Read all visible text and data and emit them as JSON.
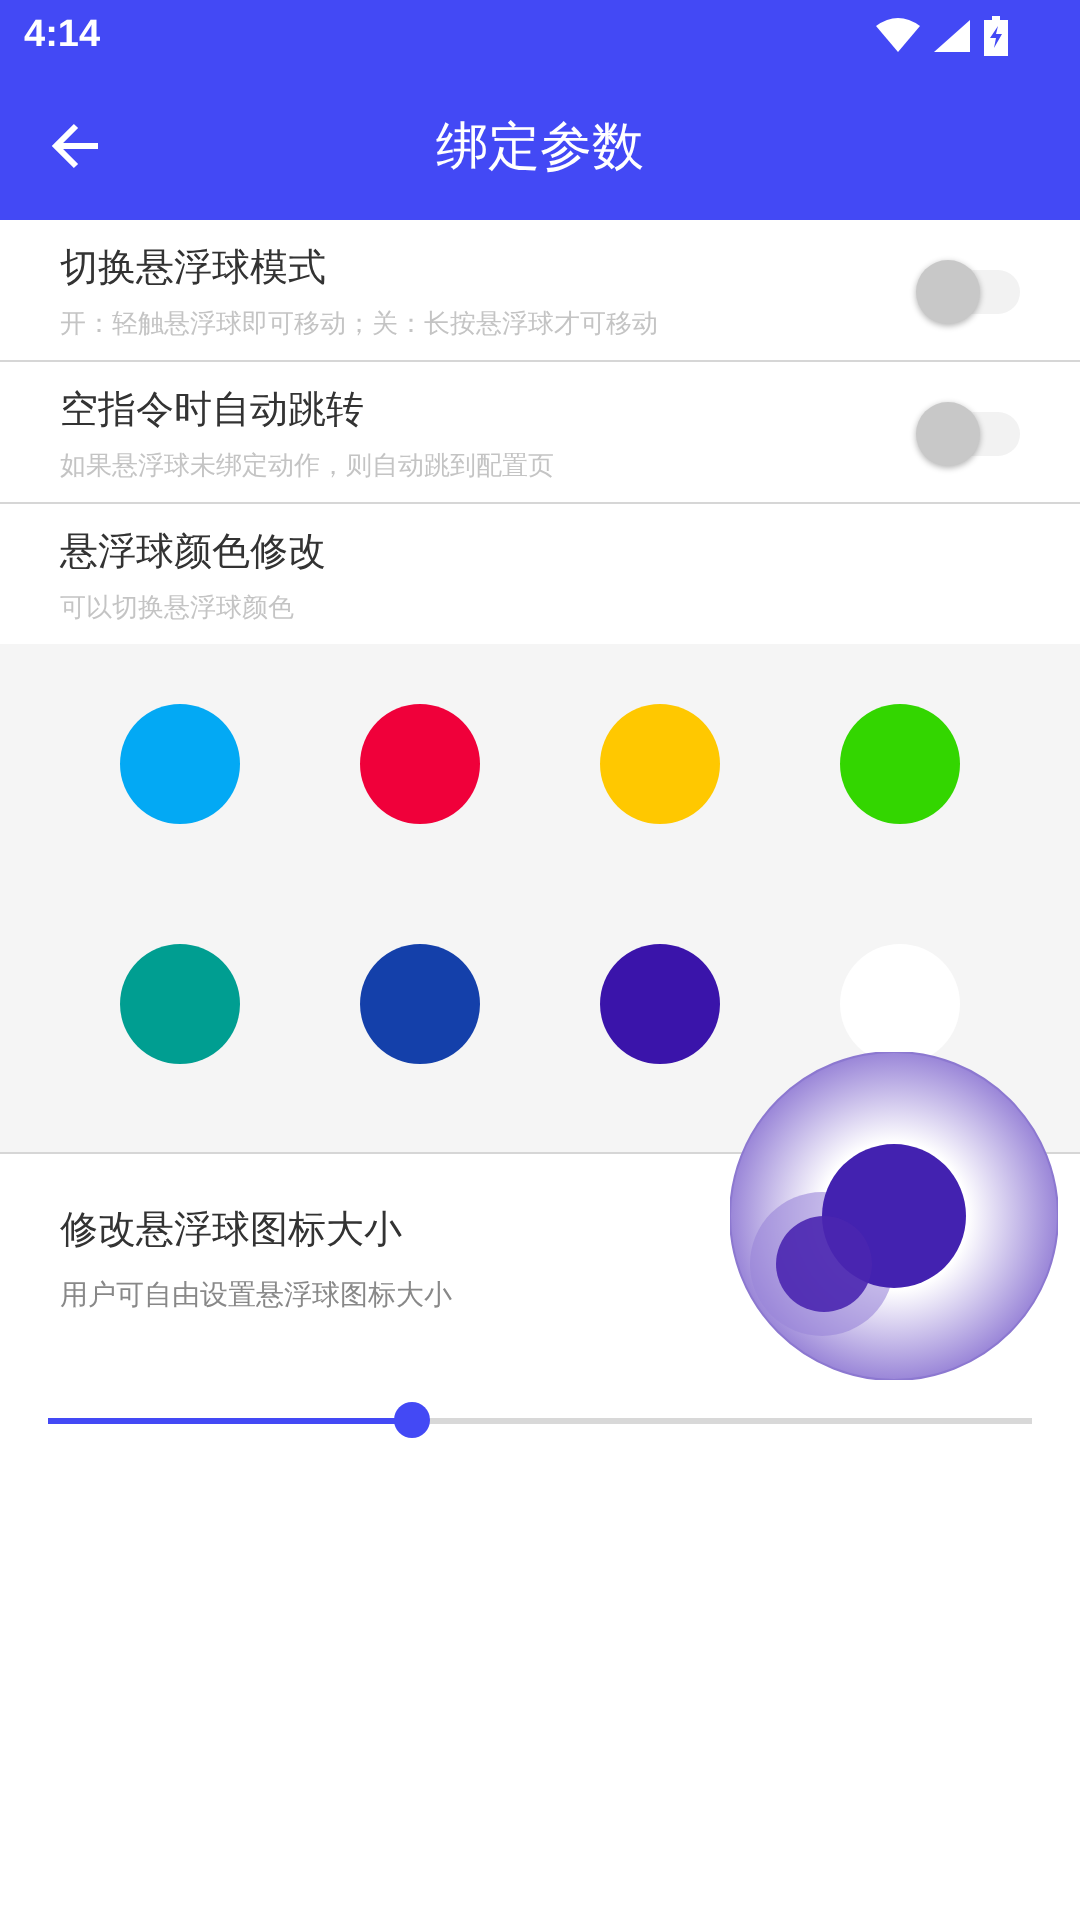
{
  "status_bar": {
    "time": "4:14"
  },
  "app_bar": {
    "title": "绑定参数"
  },
  "settings": [
    {
      "kind": "switch",
      "title": "切换悬浮球模式",
      "subtitle": "开：轻触悬浮球即可移动；关：长按悬浮球才可移动",
      "on": false
    },
    {
      "kind": "switch",
      "title": "空指令时自动跳转",
      "subtitle": "如果悬浮球未绑定动作，则自动跳到配置页",
      "on": false
    },
    {
      "kind": "colors",
      "title": "悬浮球颜色修改",
      "subtitle": "可以切换悬浮球颜色",
      "colors": [
        {
          "color": "#03a9f4"
        },
        {
          "color": "#f0003a"
        },
        {
          "color": "#ffc800"
        },
        {
          "color": "#33d600"
        },
        {
          "color": "#009e91"
        },
        {
          "color": "#1440aa"
        },
        {
          "color": "#3a14aa"
        },
        {
          "color": "#ffffff"
        }
      ]
    },
    {
      "kind": "slider",
      "title": "修改悬浮球图标大小",
      "subtitle": "用户可自由设置悬浮球图标大小",
      "level": 0.37
    }
  ]
}
